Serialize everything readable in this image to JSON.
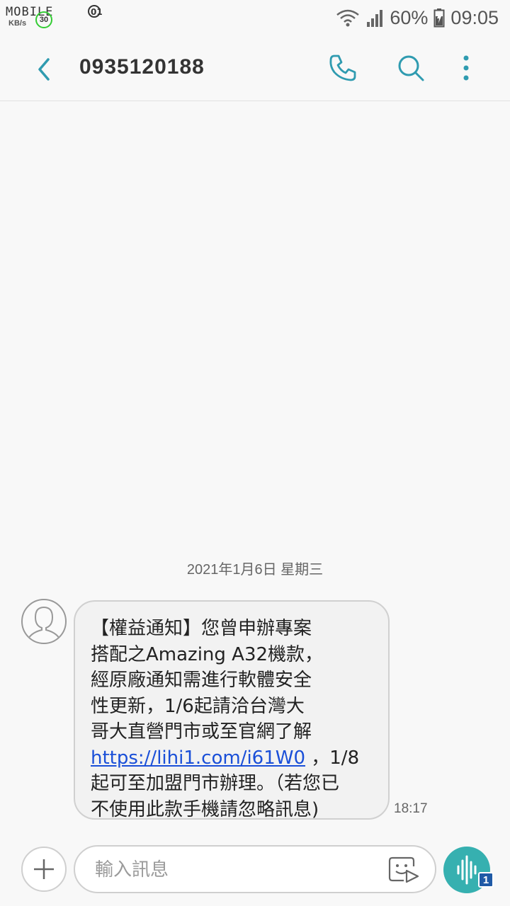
{
  "status_bar": {
    "logo_text": "MOBILE01",
    "speed_unit": "KB/s",
    "speed_value": "30",
    "battery": "60%",
    "time": "09:05"
  },
  "header": {
    "title": "0935120188",
    "icons": [
      "back-icon",
      "phone-icon",
      "search-icon",
      "more-vertical-icon"
    ],
    "accent_color": "#2f9bb0"
  },
  "conversation": {
    "date": "2021年1月6日 星期三",
    "message": {
      "lines": [
        "【權益通知】您曾申辦專案",
        "搭配之Amazing A32機款，",
        "經原廠通知需進行軟體安全",
        "性更新，1/6起請洽台灣大",
        "哥大直營門市或至官網了解"
      ],
      "link": "https://lihi1.com/i61W0",
      "link_suffix": "，1/8",
      "lines_after": [
        "起可至加盟門市辦理。（若您已",
        "不使用此款手機請忽略訊息)"
      ],
      "time": "18:17"
    }
  },
  "composer": {
    "placeholder": "輸入訊息",
    "voice_badge": "1",
    "voice_color": "#36b0b0"
  }
}
